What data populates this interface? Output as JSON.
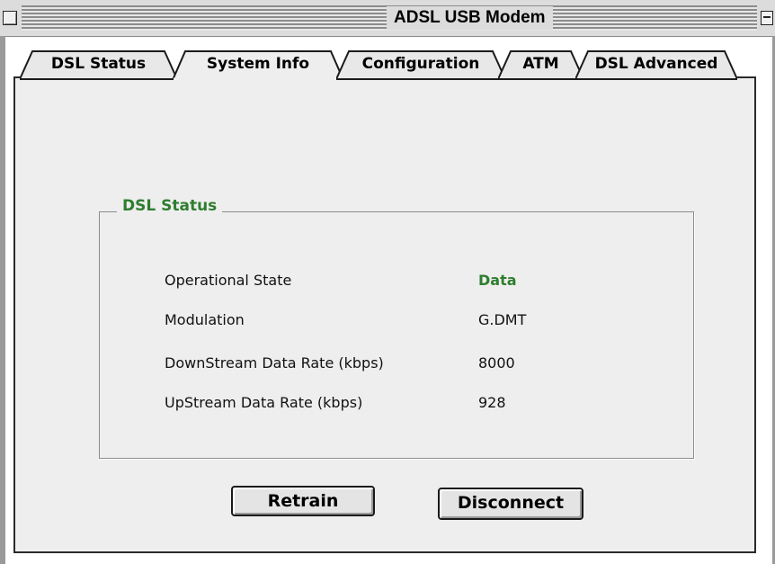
{
  "window": {
    "title": "ADSL USB Modem"
  },
  "tabs": [
    {
      "label": "DSL Status",
      "selected": false
    },
    {
      "label": "System Info",
      "selected": true
    },
    {
      "label": "Configuration",
      "selected": false
    },
    {
      "label": "ATM",
      "selected": false
    },
    {
      "label": "DSL Advanced",
      "selected": false
    }
  ],
  "group": {
    "title": "DSL Status",
    "rows": [
      {
        "label": "Operational State",
        "value": "Data"
      },
      {
        "label": "Modulation",
        "value": "G.DMT"
      },
      {
        "label": "DownStream Data Rate (kbps)",
        "value": "8000"
      },
      {
        "label": "UpStream Data Rate (kbps)",
        "value": "928"
      }
    ]
  },
  "buttons": {
    "retrain": "Retrain",
    "disconnect": "Disconnect"
  },
  "colors": {
    "accent_green": "#2f7d2f",
    "panel_bg": "#eeeeee"
  }
}
